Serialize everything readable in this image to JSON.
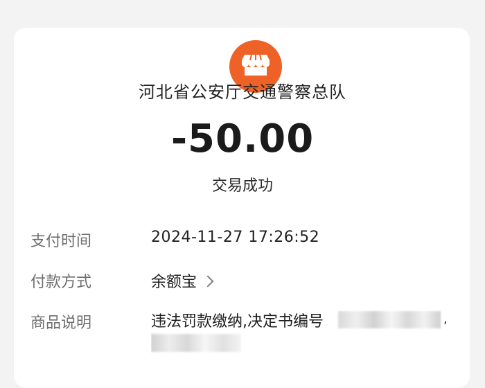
{
  "header": {
    "merchant_icon": "store-icon",
    "merchant_name": "河北省公安厅交通警察总队"
  },
  "transaction": {
    "amount": "-50.00",
    "status": "交易成功"
  },
  "details": {
    "payment_time_label": "支付时间",
    "payment_time_value": "2024-11-27 17:26:52",
    "payment_method_label": "付款方式",
    "payment_method_value": "余额宝",
    "product_desc_label": "商品说明",
    "product_desc_value": "违法罚款缴纳,决定书编号"
  },
  "colors": {
    "accent": "#ee6127",
    "text_primary": "#1f1f1f",
    "text_secondary": "#6f6f6f",
    "background": "#f3f3f3",
    "card": "#ffffff"
  }
}
